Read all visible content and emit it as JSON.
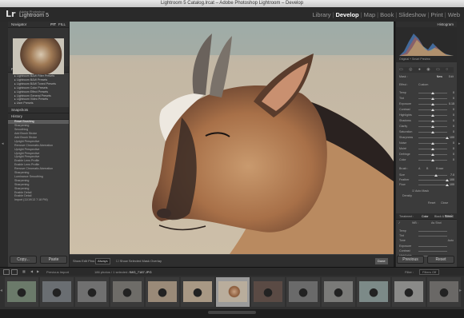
{
  "window": {
    "title": "Lightroom 5 Catalog.lrcat – Adobe Photoshop Lightroom – Develop"
  },
  "identity": {
    "logo": "Lr",
    "small": "Adobe Photoshop",
    "product": "Lightroom 5"
  },
  "modules": [
    "Library",
    "Develop",
    "Map",
    "Book",
    "Slideshow",
    "Print",
    "Web"
  ],
  "active_module": "Develop",
  "left": {
    "navigator": {
      "title": "Navigator",
      "zoom": "FIT",
      "fill": "FILL"
    },
    "presets": {
      "title": "Presets",
      "items": [
        "Lightroom B&W Filter Presets",
        "Lightroom B&W Presets",
        "Lightroom B&W Toned Presets",
        "Lightroom Color Presets",
        "Lightroom Effect Presets",
        "Lightroom General Presets",
        "Lightroom Video Presets",
        "User Presets"
      ]
    },
    "snapshots": {
      "title": "Snapshots"
    },
    "history": {
      "title": "History",
      "items": [
        {
          "label": "Reset Brushing",
          "value": ""
        },
        {
          "label": "Sharpening",
          "value": ""
        },
        {
          "label": "Smoothing",
          "value": ""
        },
        {
          "label": "Add Brush Stroke",
          "value": ""
        },
        {
          "label": "Add Brush Stroke",
          "value": ""
        },
        {
          "label": "Upright Perspective",
          "value": ""
        },
        {
          "label": "Remove Chromatic Aberration",
          "value": ""
        },
        {
          "label": "Upright Perspective",
          "value": ""
        },
        {
          "label": "Upright Perspective",
          "value": ""
        },
        {
          "label": "Upright Perspective",
          "value": ""
        },
        {
          "label": "Enable Lens Profile",
          "value": ""
        },
        {
          "label": "Enable Lens Profile",
          "value": ""
        },
        {
          "label": "Remove Chromatic Aberration",
          "value": ""
        },
        {
          "label": "Sharpening",
          "value": ""
        },
        {
          "label": "Luminance Smoothing",
          "value": ""
        },
        {
          "label": "Sharpening",
          "value": ""
        },
        {
          "label": "Sharpening",
          "value": ""
        },
        {
          "label": "Sharpening",
          "value": ""
        },
        {
          "label": "Enable Detail",
          "value": ""
        },
        {
          "label": "Enable Detail",
          "value": ""
        },
        {
          "label": "Import (11/19/13 7:18 PM)",
          "value": ""
        }
      ]
    },
    "buttons": {
      "copy": "Copy...",
      "paste": "Paste"
    }
  },
  "toolbar": {
    "show_edit_pins": "Show Edit Pins:",
    "pins_value": "Always",
    "show_overlay": "Show Selected Mask Overlay",
    "done": "Done"
  },
  "right": {
    "histogram": {
      "title": "Histogram",
      "readout": "Original + Smart Preview"
    },
    "mask": {
      "label": "Mask :",
      "new": "New",
      "edit": "Edit"
    },
    "effect": {
      "label": "Effect :",
      "value": "Custom"
    },
    "sliders": [
      {
        "label": "Temp",
        "value": "0"
      },
      {
        "label": "Tint",
        "value": "0"
      },
      {
        "label": "Exposure",
        "value": "0.15"
      },
      {
        "label": "Contrast",
        "value": "0"
      },
      {
        "label": "Highlights",
        "value": "0"
      },
      {
        "label": "Shadows",
        "value": "0"
      },
      {
        "label": "Clarity",
        "value": "0"
      },
      {
        "label": "Saturation",
        "value": "0"
      },
      {
        "label": "Sharpness",
        "value": "100"
      },
      {
        "label": "Noise",
        "value": "0"
      },
      {
        "label": "Moiré",
        "value": "0"
      },
      {
        "label": "Defringe",
        "value": "0"
      },
      {
        "label": "Color",
        "value": "0"
      }
    ],
    "brush": {
      "label": "Brush :",
      "a": "A",
      "b": "B",
      "erase": "Erase",
      "rows": [
        {
          "label": "Size",
          "value": "7.0"
        },
        {
          "label": "Feather",
          "value": "100"
        },
        {
          "label": "Flow",
          "value": "100"
        }
      ],
      "auto_mask": "Auto Mask",
      "density": "Density"
    },
    "reset": "Reset",
    "close": "Close",
    "basic": {
      "title": "Basic",
      "treatment": "Treatment :",
      "color": "Color",
      "bw": "Black & White",
      "wb": "WB :",
      "as_shot": "As Shot",
      "temp": "Temp",
      "tint": "Tint",
      "tone": "Tone",
      "auto": "Auto",
      "exposure": "Exposure",
      "contrast": "Contrast",
      "highlights": "Highlights"
    },
    "buttons": {
      "previous": "Previous",
      "reset": "Reset"
    }
  },
  "filmstrip_bar": {
    "pages": [
      "1",
      "2"
    ],
    "source": "Previous Import",
    "count": "186 photos / 1 selected /",
    "file": "IMG_7187.JPG",
    "filter_label": "Filter :",
    "filter_value": "Filters Off"
  },
  "filmstrip": {
    "thumbs": [
      {
        "color": "#6b7a6a"
      },
      {
        "color": "#6a6e72"
      },
      {
        "color": "#707070"
      },
      {
        "color": "#6e6c68"
      },
      {
        "color": "#9a8a78"
      },
      {
        "color": "#a89884"
      },
      {
        "color": "#b9ad9c",
        "selected": true
      },
      {
        "color": "#5a4a44"
      },
      {
        "color": "#6a6a6a"
      },
      {
        "color": "#7a7a78"
      },
      {
        "color": "#7c8a88"
      },
      {
        "color": "#8a8a88"
      },
      {
        "color": "#6a6866"
      }
    ]
  }
}
